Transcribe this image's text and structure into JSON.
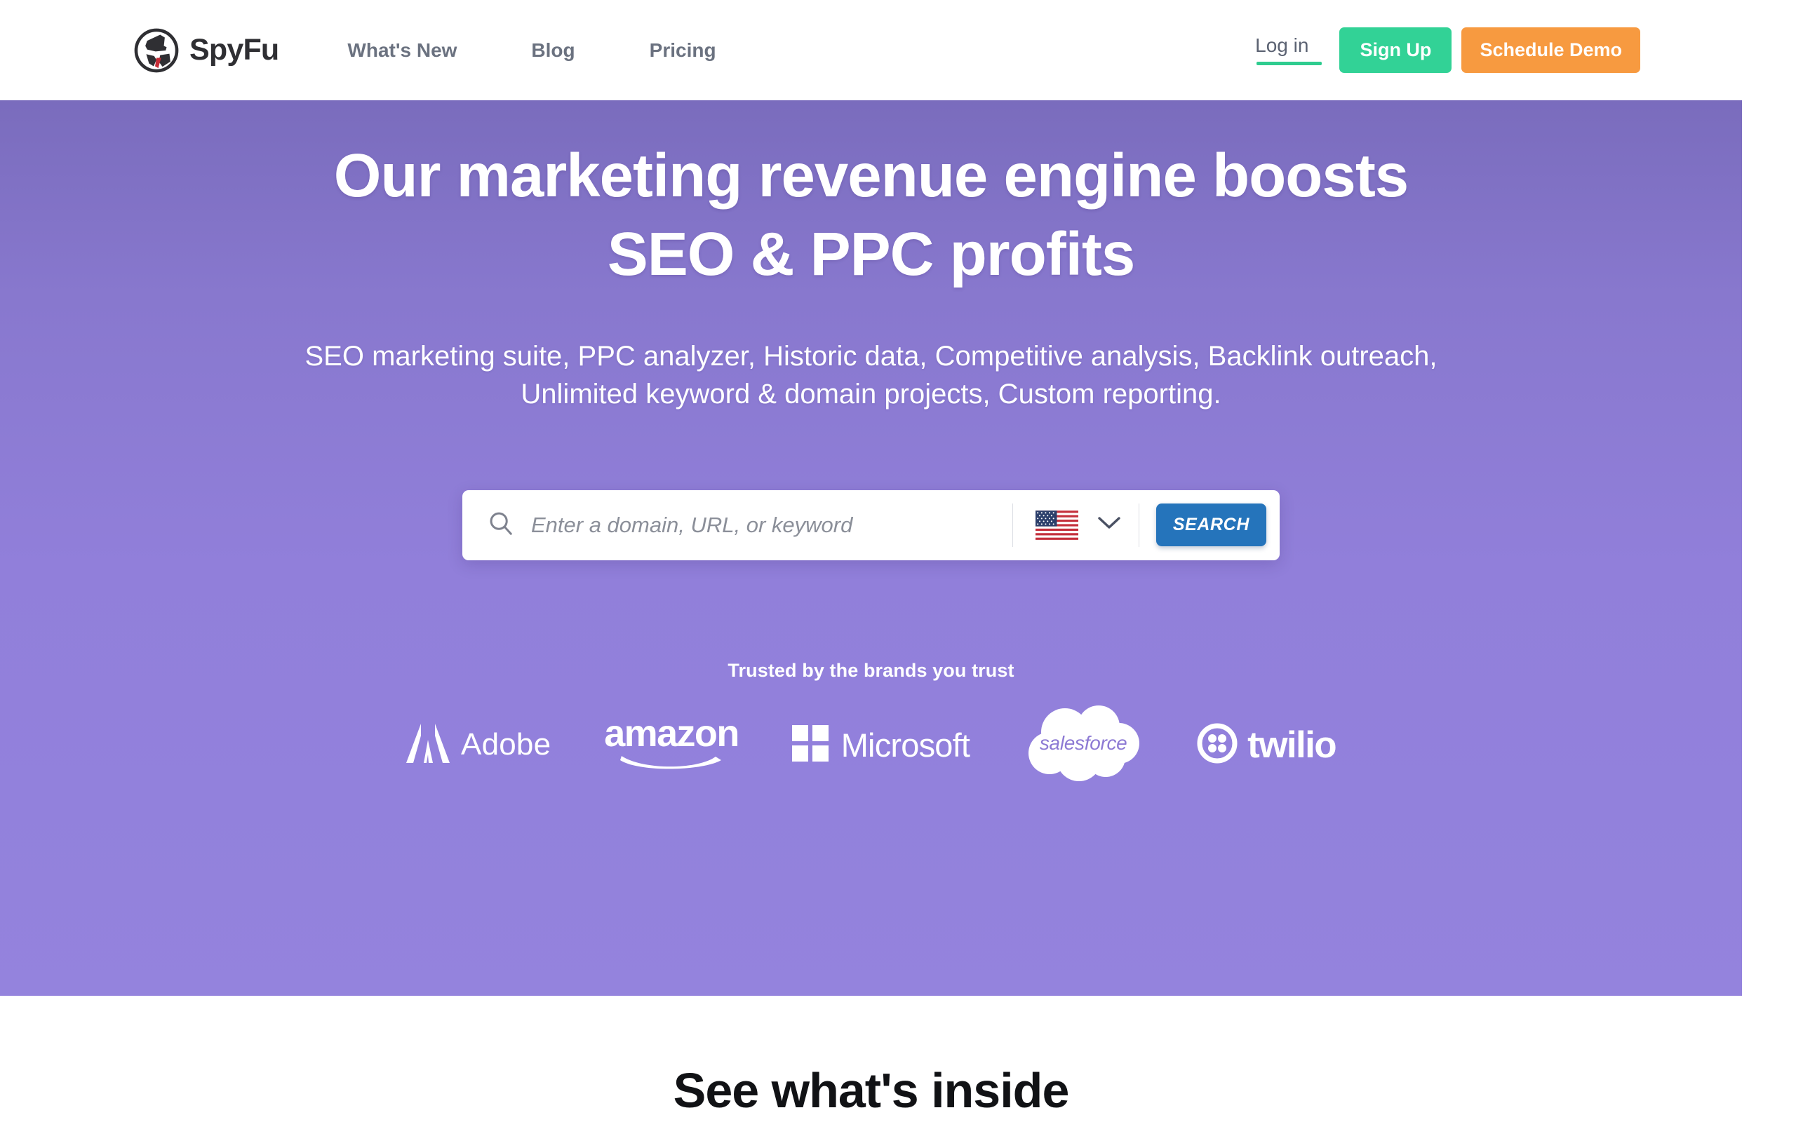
{
  "header": {
    "logo": {
      "name": "SpyFu",
      "icon": "spy-detective-icon"
    },
    "nav": [
      {
        "label": "What's New"
      },
      {
        "label": "Blog"
      },
      {
        "label": "Pricing"
      }
    ],
    "login_label": "Log in",
    "signup_label": "Sign Up",
    "demo_label": "Schedule Demo",
    "colors": {
      "signup_bg": "#32d296",
      "demo_bg": "#f79a40",
      "login_underline": "#2ecc8f",
      "nav_text": "#6b7280"
    }
  },
  "hero": {
    "title": "Our marketing revenue engine boosts SEO & PPC profits",
    "subtitle": "SEO marketing suite, PPC analyzer, Historic data, Competitive analysis, Backlink outreach, Unlimited keyword & domain projects, Custom reporting.",
    "background_top": "#7a6cbd",
    "background_bottom": "#9483dd"
  },
  "search": {
    "placeholder": "Enter a domain, URL, or keyword",
    "value": "",
    "icon": "search-icon",
    "country": {
      "flag": "us-flag-icon",
      "chevron": "chevron-down-icon"
    },
    "button_label": "SEARCH",
    "button_color": "#2574bb"
  },
  "trust": {
    "label": "Trusted by the brands you trust",
    "brands": [
      {
        "name": "Adobe",
        "icon": "adobe-logo-icon"
      },
      {
        "name": "amazon",
        "icon": "amazon-logo-icon"
      },
      {
        "name": "Microsoft",
        "icon": "microsoft-logo-icon"
      },
      {
        "name": "salesforce",
        "icon": "salesforce-cloud-icon"
      },
      {
        "name": "twilio",
        "icon": "twilio-logo-icon"
      }
    ]
  },
  "below": {
    "section_title": "See what's inside"
  }
}
